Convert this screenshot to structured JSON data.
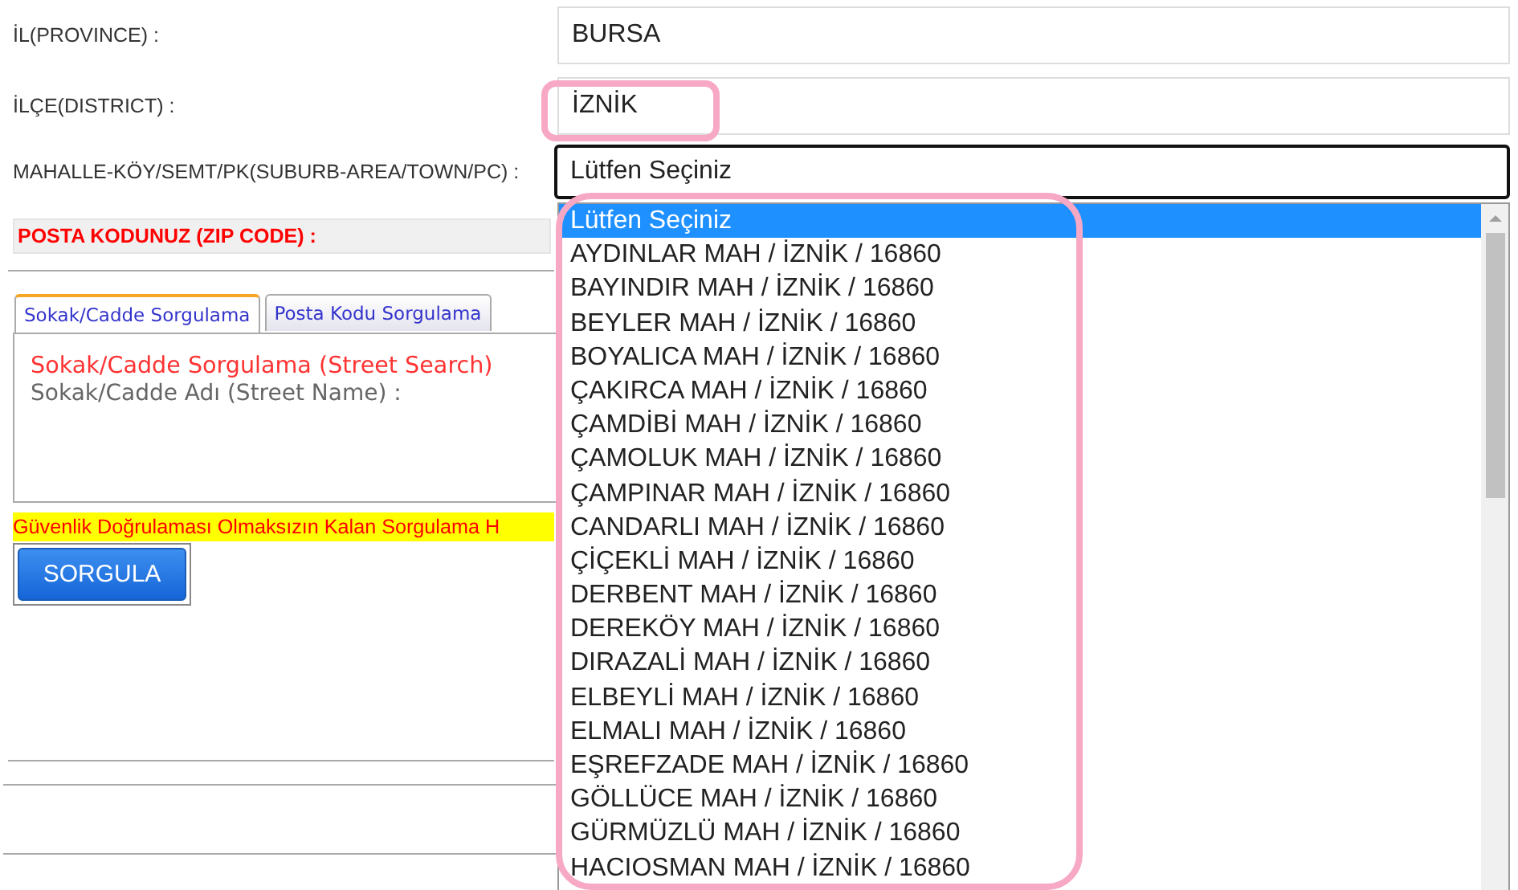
{
  "form": {
    "fields": [
      {
        "label": "İL(PROVINCE) :",
        "value": "BURSA",
        "kind": "text",
        "highlighted": false
      },
      {
        "label": "İLÇE(DISTRICT) :",
        "value": "İZNİK",
        "kind": "text",
        "highlighted": true
      },
      {
        "label": "MAHALLE-KÖY/SEMT/PK(SUBURB-AREA/TOWN/PC) :",
        "value": "Lütfen Seçiniz",
        "kind": "select",
        "highlighted": false
      }
    ],
    "zip_label": "POSTA KODUNUZ (ZIP CODE) :"
  },
  "tabs": [
    {
      "label": "Sokak/Cadde Sorgulama",
      "selected": true
    },
    {
      "label": "Posta Kodu Sorgulama",
      "selected": false
    }
  ],
  "panel": {
    "title": "Sokak/Cadde Sorgulama (Street Search)",
    "street_label": "Sokak/Cadde Adı (Street Name) :"
  },
  "notice": "Güvenlik Doğrulaması Olmaksızın Kalan Sorgulama H",
  "button": "SORGULA",
  "dropdown": {
    "highlighted": true,
    "options": [
      {
        "label": "Lütfen Seçiniz",
        "selected": true
      },
      {
        "label": "AYDINLAR MAH / İZNİK / 16860",
        "selected": false
      },
      {
        "label": "BAYINDIR MAH / İZNİK / 16860",
        "selected": false
      },
      {
        "label": "BEYLER MAH / İZNİK / 16860",
        "selected": false
      },
      {
        "label": "BOYALICA MAH / İZNİK / 16860",
        "selected": false
      },
      {
        "label": "ÇAKIRCA MAH / İZNİK / 16860",
        "selected": false
      },
      {
        "label": "ÇAMDİBİ MAH / İZNİK / 16860",
        "selected": false
      },
      {
        "label": "ÇAMOLUK MAH / İZNİK / 16860",
        "selected": false
      },
      {
        "label": "ÇAMPINAR MAH / İZNİK / 16860",
        "selected": false
      },
      {
        "label": "CANDARLI MAH / İZNİK / 16860",
        "selected": false
      },
      {
        "label": "ÇİÇEKLİ MAH / İZNİK / 16860",
        "selected": false
      },
      {
        "label": "DERBENT MAH / İZNİK / 16860",
        "selected": false
      },
      {
        "label": "DEREKÖY MAH / İZNİK / 16860",
        "selected": false
      },
      {
        "label": "DIRAZALİ MAH / İZNİK / 16860",
        "selected": false
      },
      {
        "label": "ELBEYLİ MAH / İZNİK / 16860",
        "selected": false
      },
      {
        "label": "ELMALI MAH / İZNİK / 16860",
        "selected": false
      },
      {
        "label": "EŞREFZADE MAH / İZNİK / 16860",
        "selected": false
      },
      {
        "label": "GÖLLÜCE MAH / İZNİK / 16860",
        "selected": false
      },
      {
        "label": "GÜRMÜZLÜ MAH / İZNİK / 16860",
        "selected": false
      },
      {
        "label": "HACIOSMAN MAH / İZNİK / 16860",
        "selected": false
      }
    ]
  }
}
